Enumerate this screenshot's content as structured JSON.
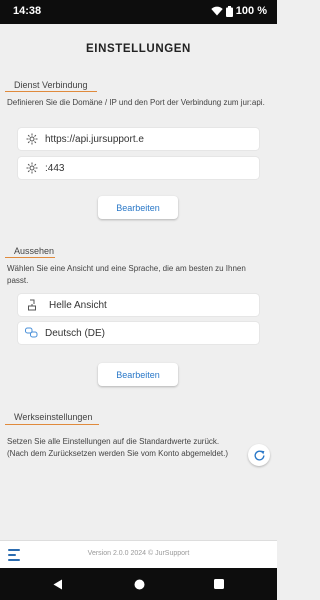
{
  "status_bar": {
    "time": "14:38",
    "battery": "100 %"
  },
  "page": {
    "title": "EINSTELLUNGEN"
  },
  "connection": {
    "title": "Dienst Verbindung",
    "description": "Definieren Sie die Domäne / IP und den Port der Verbindung zum jur:api.",
    "domain_value": "https://api.jursupport.e",
    "port_value": ":443",
    "edit_label": "Bearbeiten"
  },
  "appearance": {
    "title": "Aussehen",
    "description": "Wählen Sie eine Ansicht und eine Sprache, die am besten zu Ihnen passt.",
    "theme_value": "Helle Ansicht",
    "language_value": "Deutsch (DE)",
    "edit_label": "Bearbeiten"
  },
  "factory": {
    "title": "Werkseinstellungen",
    "description": "Setzen Sie alle Einstellungen auf die Standardwerte zurück. (Nach dem Zurücksetzen werden Sie vom Konto abgemeldet.)"
  },
  "footer": {
    "version": "Version 2.0.0 2024 © JurSupport"
  },
  "colors": {
    "accent": "#e08a3c",
    "link": "#2a78c8",
    "menu": "#2b6cb0"
  },
  "icons": [
    "wifi-icon",
    "battery-icon",
    "gear-icon",
    "theme-icon",
    "language-icon",
    "reset-icon",
    "menu-icon",
    "back-icon",
    "home-icon",
    "recents-icon"
  ]
}
